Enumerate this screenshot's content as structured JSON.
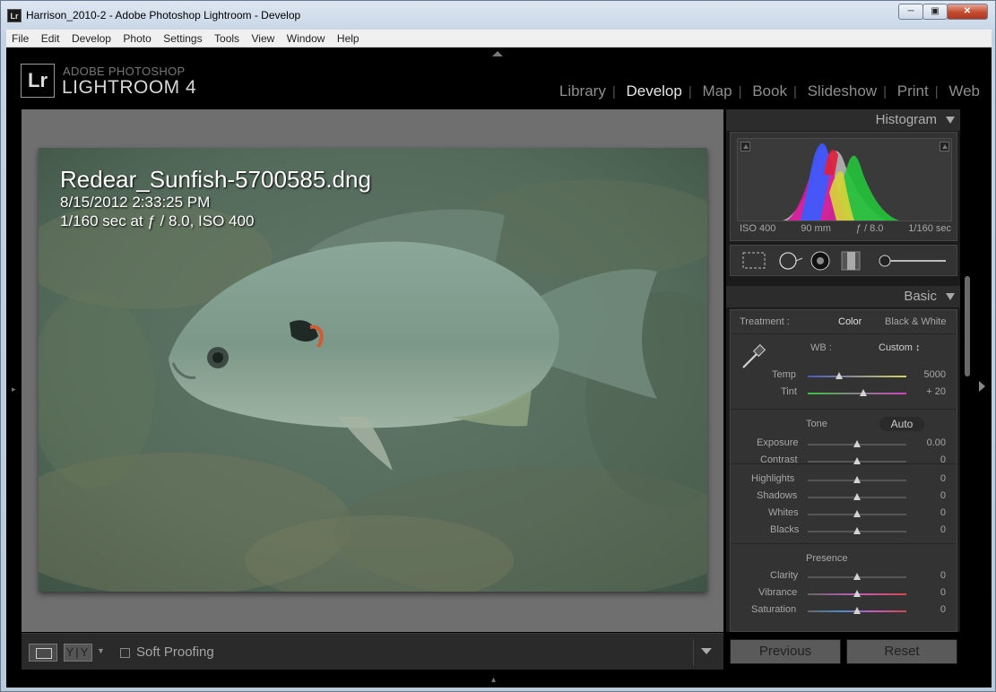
{
  "window": {
    "title": "Harrison_2010-2 - Adobe Photoshop Lightroom - Develop",
    "app_icon": "Lr",
    "controls": [
      "minimize-icon",
      "maximize-icon",
      "close-icon"
    ]
  },
  "menu": [
    "File",
    "Edit",
    "Develop",
    "Photo",
    "Settings",
    "Tools",
    "View",
    "Window",
    "Help"
  ],
  "brand": {
    "logo": "Lr",
    "top": "ADOBE PHOTOSHOP",
    "name": "LIGHTROOM 4"
  },
  "modules": [
    {
      "label": "Library",
      "active": false
    },
    {
      "label": "Develop",
      "active": true
    },
    {
      "label": "Map",
      "active": false
    },
    {
      "label": "Book",
      "active": false
    },
    {
      "label": "Slideshow",
      "active": false
    },
    {
      "label": "Print",
      "active": false
    },
    {
      "label": "Web",
      "active": false
    }
  ],
  "photo_info": {
    "filename": "Redear_Sunfish-5700585.dng",
    "date": "8/15/2012 2:33:25 PM",
    "exif": "1/160 sec at ƒ / 8.0, ISO 400"
  },
  "toolbar": {
    "compare_label": "Y|Y",
    "soft_proofing": "Soft Proofing",
    "soft_proofing_checked": false
  },
  "histogram": {
    "title": "Histogram",
    "iso": "ISO 400",
    "focal": "90 mm",
    "aperture": "ƒ / 8.0",
    "shutter": "1/160 sec",
    "colors": {
      "red": "#e0203c",
      "green": "#25c13a",
      "blue": "#3b5bff",
      "magenta": "#d6199a",
      "yellow": "#d7d23a",
      "gray": "#b4b4b4"
    }
  },
  "tools": [
    "crop-overlay-icon",
    "spot-removal-icon",
    "red-eye-icon",
    "graduated-filter-icon",
    "adjustment-brush-icon"
  ],
  "basic": {
    "title": "Basic",
    "treatment_label": "Treatment :",
    "treatment_color": "Color",
    "treatment_bw": "Black & White",
    "wb_label": "WB :",
    "wb_value": "Custom ↕",
    "temp": {
      "label": "Temp",
      "value": "5000",
      "position": 0.32
    },
    "tint": {
      "label": "Tint",
      "value": "+ 20",
      "position": 0.56
    },
    "tone_label": "Tone",
    "auto_label": "Auto",
    "exposure": {
      "label": "Exposure",
      "value": "0.00",
      "position": 0.5
    },
    "contrast": {
      "label": "Contrast",
      "value": "0",
      "position": 0.5
    },
    "highlights": {
      "label": "Highlights",
      "value": "0",
      "position": 0.5
    },
    "shadows": {
      "label": "Shadows",
      "value": "0",
      "position": 0.5
    },
    "whites": {
      "label": "Whites",
      "value": "0",
      "position": 0.5
    },
    "blacks": {
      "label": "Blacks",
      "value": "0",
      "position": 0.5
    },
    "presence_label": "Presence",
    "clarity": {
      "label": "Clarity",
      "value": "0",
      "position": 0.5
    },
    "vibrance": {
      "label": "Vibrance",
      "value": "0",
      "position": 0.5
    },
    "saturation": {
      "label": "Saturation",
      "value": "0",
      "position": 0.5
    }
  },
  "buttons": {
    "previous": "Previous",
    "reset": "Reset"
  }
}
